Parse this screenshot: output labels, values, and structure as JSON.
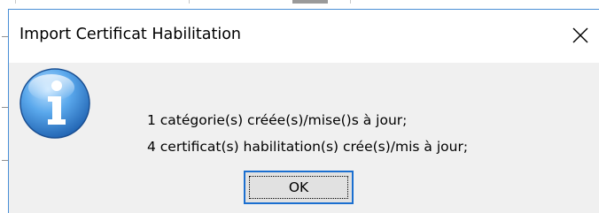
{
  "dialog": {
    "title": "Import Certificat Habilitation",
    "close_icon": "close-icon",
    "status_icon": "info-icon",
    "message_lines": [
      "1 catégorie(s) créée(s)/mise()s à jour;",
      "4 certificat(s) habilitation(s) crée(s)/mis à jour;"
    ],
    "ok_label": "OK"
  },
  "colors": {
    "window_border": "#4a8fd6",
    "dialog_body": "#f0f0f0",
    "titlebar": "#ffffff",
    "button_border_focus": "#1b6fd0",
    "info_icon_blue": "#2f7fd0"
  }
}
